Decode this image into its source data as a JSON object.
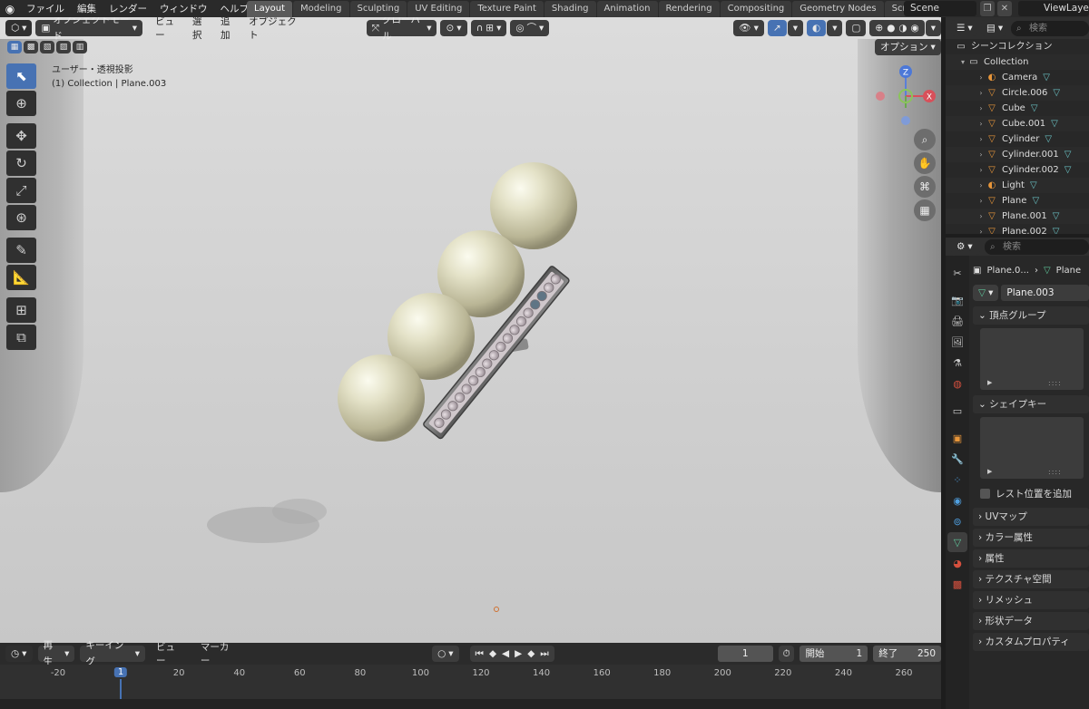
{
  "topbar": {
    "menus": [
      "ファイル",
      "編集",
      "レンダー",
      "ウィンドウ",
      "ヘルプ"
    ],
    "workspaces": [
      {
        "label": "Layout",
        "active": true
      },
      {
        "label": "Modeling",
        "active": false
      },
      {
        "label": "Sculpting",
        "active": false
      },
      {
        "label": "UV Editing",
        "active": false
      },
      {
        "label": "Texture Paint",
        "active": false
      },
      {
        "label": "Shading",
        "active": false
      },
      {
        "label": "Animation",
        "active": false
      },
      {
        "label": "Rendering",
        "active": false
      },
      {
        "label": "Compositing",
        "active": false
      },
      {
        "label": "Geometry Nodes",
        "active": false
      },
      {
        "label": "Scripting",
        "active": false
      }
    ],
    "scene": "Scene",
    "view_layer": "ViewLayer"
  },
  "viewport": {
    "mode": "オブジェクトモード",
    "menus": [
      "ビュー",
      "選択",
      "追加",
      "オブジェクト"
    ],
    "transform_orientation": "グローバル",
    "options_label": "オプション",
    "info_line1": "ユーザー・透視投影",
    "info_line2": "(1) Collection | Plane.003",
    "gizmo_axes": {
      "x": "X",
      "z": "Z"
    }
  },
  "timeline": {
    "menus": [
      "再生",
      "キーイング",
      "ビュー",
      "マーカー"
    ],
    "current_frame": "1",
    "start_label": "開始",
    "start_value": "1",
    "end_label": "終了",
    "end_value": "250",
    "ruler_ticks": [
      "-20",
      "20",
      "40",
      "60",
      "80",
      "100",
      "120",
      "140",
      "160",
      "180",
      "200",
      "220",
      "240",
      "260"
    ],
    "ruler_current": "1"
  },
  "outliner": {
    "search_placeholder": "検索",
    "scene_collection": "シーンコレクション",
    "collection": "Collection",
    "items": [
      "Camera",
      "Circle.006",
      "Cube",
      "Cube.001",
      "Cylinder",
      "Cylinder.001",
      "Cylinder.002",
      "Light",
      "Plane",
      "Plane.001",
      "Plane.002"
    ]
  },
  "properties": {
    "search_placeholder": "検索",
    "breadcrumb_object": "Plane.0...",
    "breadcrumb_data": "Plane",
    "data_name": "Plane.003",
    "vertex_groups": "頂点グループ",
    "shape_keys": "シェイプキー",
    "add_rest_position": "レスト位置を追加",
    "collapsed_panels": [
      "UVマップ",
      "カラー属性",
      "属性",
      "テクスチャ空間",
      "リメッシュ",
      "形状データ",
      "カスタムプロパティ"
    ]
  },
  "colors": {
    "accent": "#4772b3",
    "header_bg": "#2a2a2a",
    "orange_icon": "#e8963a",
    "green_icon": "#5fc59a"
  }
}
